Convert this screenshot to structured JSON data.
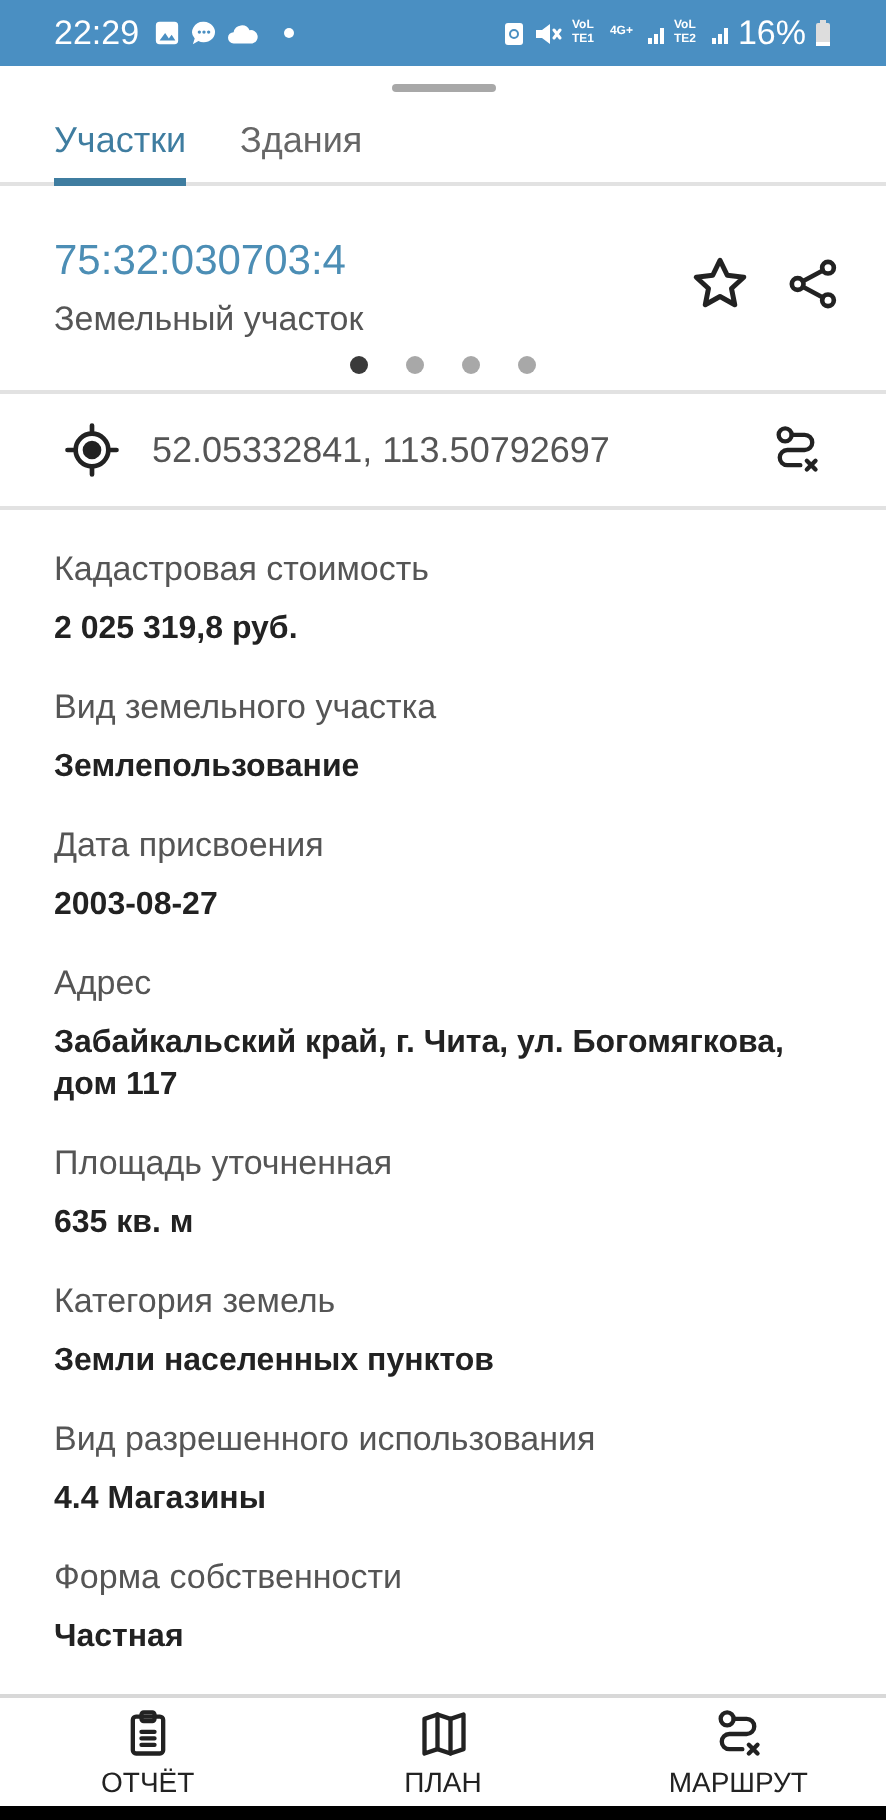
{
  "status_bar": {
    "time": "22:29",
    "sim1": [
      "VoLTE1",
      "4G+"
    ],
    "sim2": "VoLTE2",
    "battery": "16%"
  },
  "tabs": [
    {
      "label": "Участки",
      "selected": true
    },
    {
      "label": "Здания",
      "selected": false
    }
  ],
  "header": {
    "title": "75:32:030703:4",
    "subtitle": "Земельный участок",
    "favorite": false
  },
  "pager": [
    {
      "selected": true
    },
    {
      "selected": false
    },
    {
      "selected": false
    },
    {
      "selected": false
    }
  ],
  "coordinates": "52.05332841, 113.50792697",
  "fields": [
    {
      "label": "Кадастровая стоимость",
      "value": "2 025 319,8 руб."
    },
    {
      "label": "Вид земельного участка",
      "value": "Землепользование"
    },
    {
      "label": "Дата присвоения",
      "value": "2003-08-27"
    },
    {
      "label": "Адрес",
      "value": "Забайкальский край, г. Чита, ул. Богомягкова, дом 117"
    },
    {
      "label": "Площадь уточненная",
      "value": "635 кв. м"
    },
    {
      "label": "Категория земель",
      "value": "Земли населенных пунктов"
    },
    {
      "label": "Вид разрешенного использования",
      "value": "4.4 Магазины"
    },
    {
      "label": "Форма собственности",
      "value": "Частная"
    }
  ],
  "bottom_nav": [
    {
      "kind": "report",
      "label": "ОТЧЁТ"
    },
    {
      "kind": "plan",
      "label": "ПЛАН"
    },
    {
      "kind": "route",
      "label": "МАРШРУТ"
    }
  ]
}
